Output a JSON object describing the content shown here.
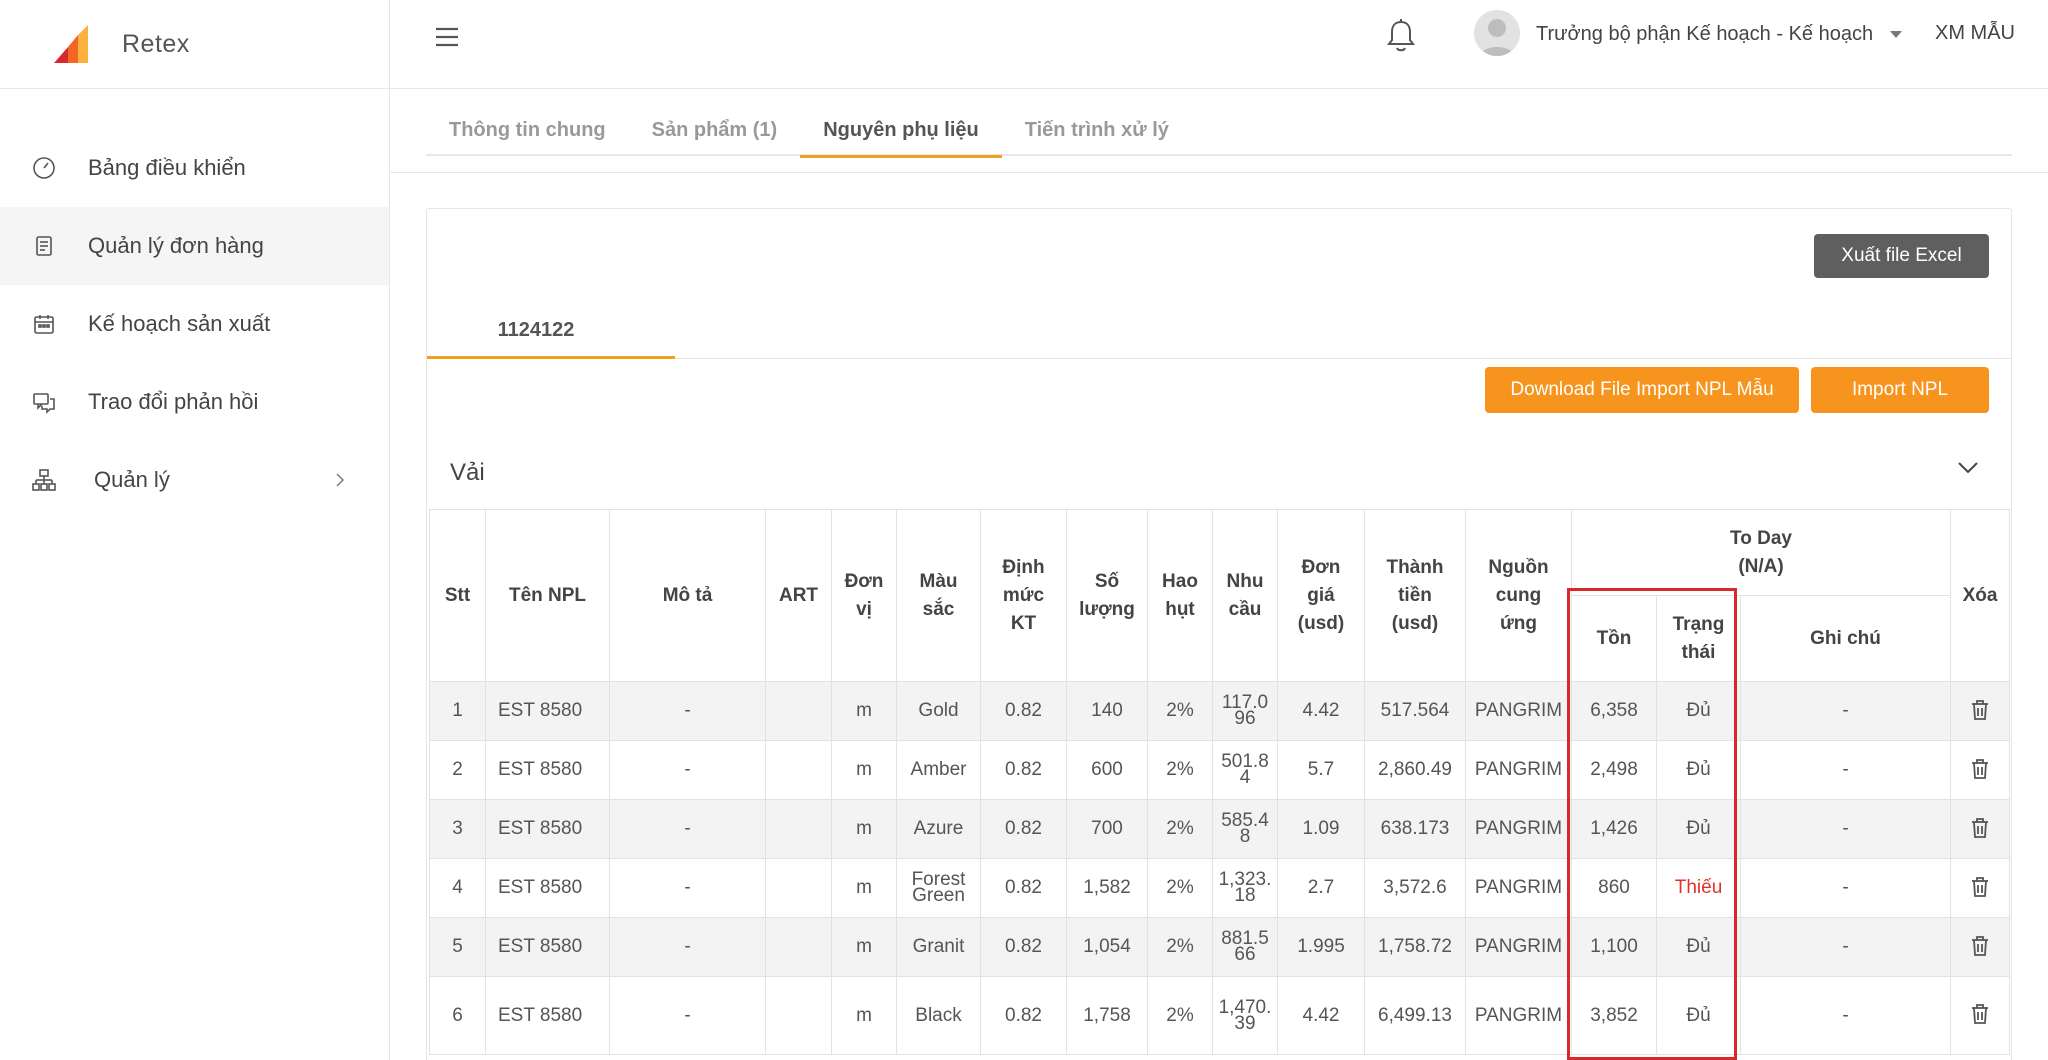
{
  "app": {
    "name": "Retex"
  },
  "sidebar": {
    "items": [
      {
        "label": "Bảng điều khiển",
        "icon": "dashboard-icon"
      },
      {
        "label": "Quản lý đơn hàng",
        "icon": "orders-icon"
      },
      {
        "label": "Kế hoạch sản xuất",
        "icon": "calendar-icon"
      },
      {
        "label": "Trao đổi phản hồi",
        "icon": "chat-icon"
      },
      {
        "label": "Quản lý",
        "icon": "org-chart-icon"
      }
    ]
  },
  "header": {
    "user_name": "Trưởng bộ phận Kế hoạch - Kế hoạch",
    "company": "XM MẪU"
  },
  "tabs": [
    {
      "label": "Thông tin chung"
    },
    {
      "label": "Sản phẩm (1)"
    },
    {
      "label": "Nguyên phụ liệu"
    },
    {
      "label": "Tiến trình xử lý"
    }
  ],
  "card": {
    "export_label": "Xuất file Excel",
    "subtab_label": "1124122",
    "download_label": "Download File Import NPL Mẫu",
    "import_label": "Import NPL",
    "section_title": "Vải"
  },
  "table": {
    "headers": {
      "stt": "Stt",
      "name": "Tên NPL",
      "desc": "Mô tả",
      "art": "ART",
      "unit": "Đơn vị",
      "color": "Màu sắc",
      "norm": "Định mức KT",
      "qty": "Số lượng",
      "loss": "Hao hụt",
      "need": "Nhu cầu",
      "price": "Đơn giá (usd)",
      "amount": "Thành tiền (usd)",
      "source": "Nguồn cung ứng",
      "today": "To Day",
      "today_sub": "(N/A)",
      "stock": "Tồn",
      "status": "Trạng thái",
      "note": "Ghi chú",
      "delete": "Xóa"
    },
    "rows": [
      {
        "stt": "1",
        "name": "EST 8580",
        "desc": "-",
        "art": "",
        "unit": "m",
        "color": "Gold",
        "norm": "0.82",
        "qty": "140",
        "loss": "2%",
        "need": "117.096",
        "price": "4.42",
        "amount": "517.564",
        "source": "PANGRIM",
        "stock": "6,358",
        "status": "Đủ",
        "note": "-"
      },
      {
        "stt": "2",
        "name": "EST 8580",
        "desc": "-",
        "art": "",
        "unit": "m",
        "color": "Amber",
        "norm": "0.82",
        "qty": "600",
        "loss": "2%",
        "need": "501.84",
        "price": "5.7",
        "amount": "2,860.49",
        "source": "PANGRIM",
        "stock": "2,498",
        "status": "Đủ",
        "note": "-"
      },
      {
        "stt": "3",
        "name": "EST 8580",
        "desc": "-",
        "art": "",
        "unit": "m",
        "color": "Azure",
        "norm": "0.82",
        "qty": "700",
        "loss": "2%",
        "need": "585.48",
        "price": "1.09",
        "amount": "638.173",
        "source": "PANGRIM",
        "stock": "1,426",
        "status": "Đủ",
        "note": "-"
      },
      {
        "stt": "4",
        "name": "EST 8580",
        "desc": "-",
        "art": "",
        "unit": "m",
        "color": "Forest Green",
        "norm": "0.82",
        "qty": "1,582",
        "loss": "2%",
        "need": "1,323.18",
        "price": "2.7",
        "amount": "3,572.6",
        "source": "PANGRIM",
        "stock": "860",
        "status": "Thiếu",
        "note": "-"
      },
      {
        "stt": "5",
        "name": "EST 8580",
        "desc": "-",
        "art": "",
        "unit": "m",
        "color": "Granit",
        "norm": "0.82",
        "qty": "1,054",
        "loss": "2%",
        "need": "881.566",
        "price": "1.995",
        "amount": "1,758.72",
        "source": "PANGRIM",
        "stock": "1,100",
        "status": "Đủ",
        "note": "-"
      },
      {
        "stt": "6",
        "name": "EST 8580",
        "desc": "-",
        "art": "",
        "unit": "m",
        "color": "Black",
        "norm": "0.82",
        "qty": "1,758",
        "loss": "2%",
        "need": "1,470.39",
        "price": "4.42",
        "amount": "6,499.13",
        "source": "PANGRIM",
        "stock": "3,852",
        "status": "Đủ",
        "note": "-"
      }
    ]
  },
  "colors": {
    "accent": "#f7941d",
    "tab_underline": "#f0a020",
    "danger": "#e0312a",
    "highlight_box": "#d9282d"
  }
}
